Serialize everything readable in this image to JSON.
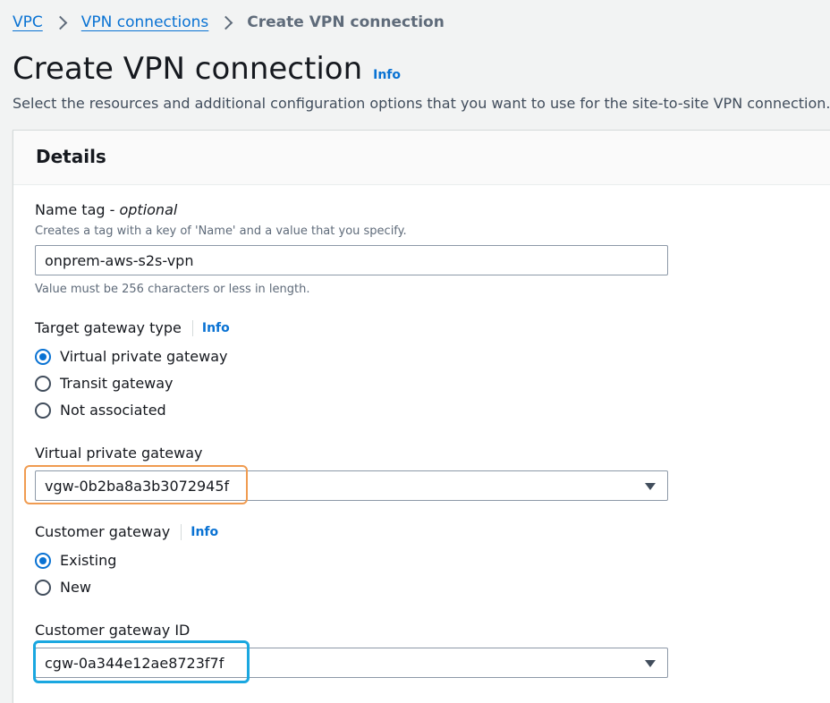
{
  "breadcrumb": {
    "items": [
      {
        "label": "VPC"
      },
      {
        "label": "VPN connections"
      }
    ],
    "current": "Create VPN connection"
  },
  "page": {
    "title": "Create VPN connection",
    "info_label": "Info",
    "description": "Select the resources and additional configuration options that you want to use for the site-to-site VPN connection."
  },
  "details": {
    "title": "Details",
    "name_tag": {
      "label": "Name tag - ",
      "label_optional": "optional",
      "description": "Creates a tag with a key of 'Name' and a value that you specify.",
      "value": "onprem-aws-s2s-vpn",
      "constraint": "Value must be 256 characters or less in length."
    },
    "target_gateway_type": {
      "label": "Target gateway type",
      "info_label": "Info",
      "options": [
        {
          "label": "Virtual private gateway",
          "checked": true
        },
        {
          "label": "Transit gateway",
          "checked": false
        },
        {
          "label": "Not associated",
          "checked": false
        }
      ]
    },
    "virtual_private_gateway": {
      "label": "Virtual private gateway",
      "value": "vgw-0b2ba8a3b3072945f"
    },
    "customer_gateway": {
      "label": "Customer gateway",
      "info_label": "Info",
      "options": [
        {
          "label": "Existing",
          "checked": true
        },
        {
          "label": "New",
          "checked": false
        }
      ]
    },
    "customer_gateway_id": {
      "label": "Customer gateway ID",
      "value": "cgw-0a344e12ae8723f7f"
    }
  },
  "colors": {
    "link": "#0972d3",
    "highlight_orange": "#f09b50",
    "highlight_blue": "#1aa7e0"
  }
}
